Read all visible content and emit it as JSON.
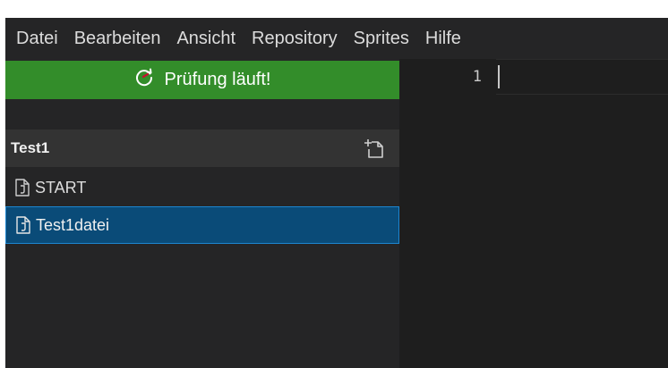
{
  "menu": {
    "items": [
      {
        "label": "Datei"
      },
      {
        "label": "Bearbeiten"
      },
      {
        "label": "Ansicht"
      },
      {
        "label": "Repository"
      },
      {
        "label": "Sprites"
      },
      {
        "label": "Hilfe"
      }
    ]
  },
  "status": {
    "label": "Prüfung läuft!",
    "icon": "refresh-icon",
    "color": "#338d2a"
  },
  "project": {
    "title": "Test1",
    "new_file_icon": "new-file-icon"
  },
  "files": [
    {
      "name": "START",
      "icon": "file-icon",
      "selected": false
    },
    {
      "name": "Test1datei",
      "icon": "file-icon",
      "selected": true
    }
  ],
  "editor": {
    "line_number": "1"
  },
  "colors": {
    "accent_selected": "#0a4b78",
    "accent_selected_border": "#1d86d0",
    "status_green": "#338d2a"
  }
}
